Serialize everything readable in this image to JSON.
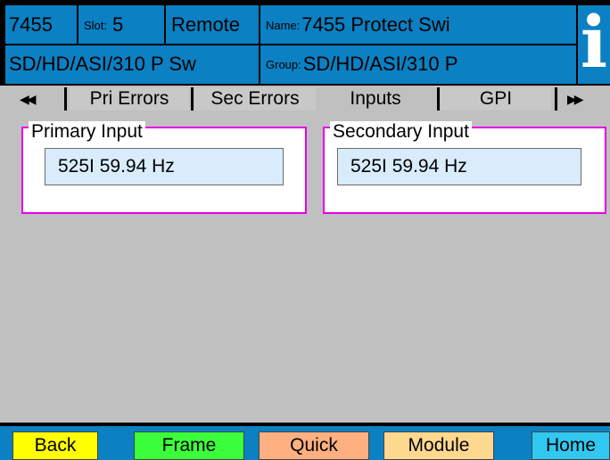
{
  "header": {
    "model": "7455",
    "slot_label": "Slot:",
    "slot_value": "5",
    "mode": "Remote",
    "name_label": "Name:",
    "name_value": "7455 Protect Swi",
    "type": "SD/HD/ASI/310 P Sw",
    "group_label": "Group:",
    "group_value": "SD/HD/ASI/310 P"
  },
  "info_icon": "info-icon",
  "tabs": {
    "prev_icon": "◀◀",
    "items": [
      {
        "label": "Pri Errors"
      },
      {
        "label": "Sec Errors"
      },
      {
        "label": "Inputs"
      },
      {
        "label": "GPI"
      }
    ],
    "selected": "Inputs",
    "next_icon": "▶▶"
  },
  "panels": {
    "primary": {
      "title": "Primary Input",
      "value": "525I 59.94 Hz"
    },
    "secondary": {
      "title": "Secondary Input",
      "value": "525I 59.94 Hz"
    }
  },
  "buttons": {
    "back": {
      "label": "Back",
      "color": "#ffff00"
    },
    "frame": {
      "label": "Frame",
      "color": "#3cff3c"
    },
    "quick": {
      "label": "Quick",
      "color": "#ffb080"
    },
    "module": {
      "label": "Module",
      "color": "#ffd890"
    },
    "home": {
      "label": "Home",
      "color": "#30c8f0"
    }
  },
  "colors": {
    "header_bg": "#0b80c2",
    "panel_border": "#e800e8",
    "value_bg": "#d8ecfc",
    "work_area": "#c0c0c0"
  }
}
